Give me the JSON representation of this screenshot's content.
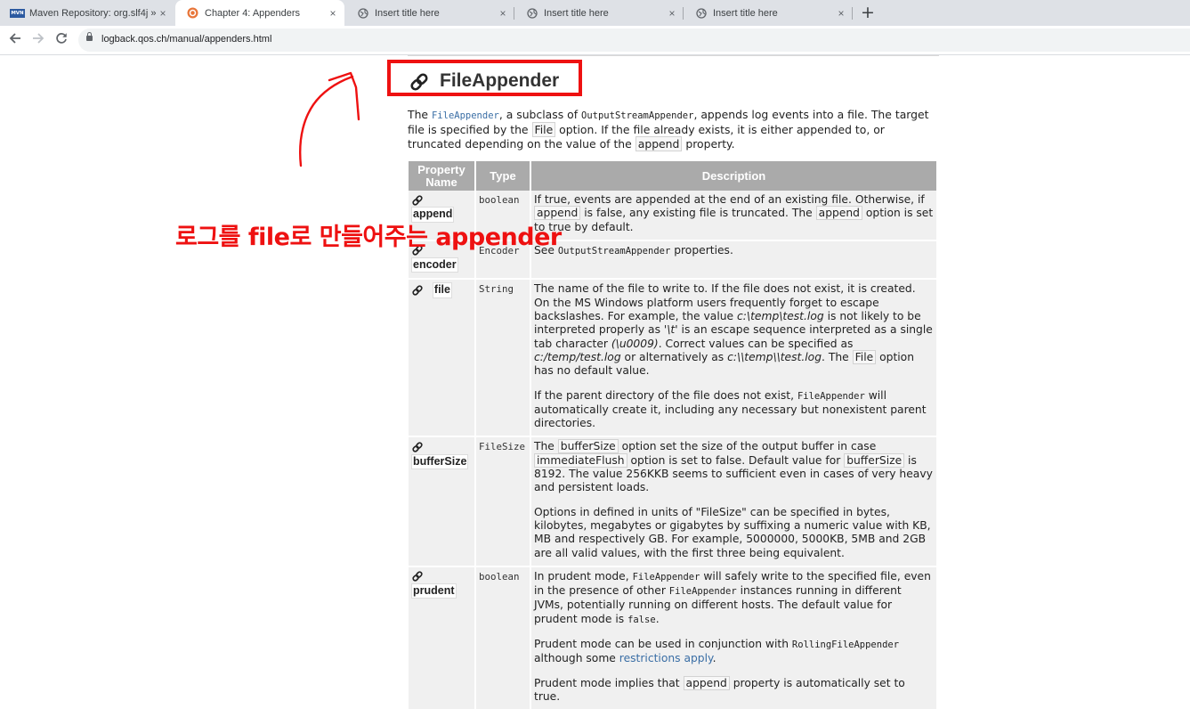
{
  "browser": {
    "tabs": [
      {
        "title": "Maven Repository: org.slf4j » slf",
        "icon": "maven-favicon",
        "active": false
      },
      {
        "title": "Chapter 4: Appenders",
        "icon": "logback-favicon",
        "active": true
      },
      {
        "title": "Insert title here",
        "icon": "globe-favicon",
        "active": false
      },
      {
        "title": "Insert title here",
        "icon": "globe-favicon",
        "active": false
      },
      {
        "title": "Insert title here",
        "icon": "globe-favicon",
        "active": false
      }
    ],
    "close_glyph": "×",
    "new_tab_glyph": "+",
    "maven_fav_text": "MVN",
    "url": "logback.qos.ch/manual/appenders.html"
  },
  "page": {
    "heading": "FileAppender",
    "intro": {
      "p1": "The ",
      "c1": "FileAppender",
      "p2": ", a subclass of ",
      "c2": "OutputStreamAppender",
      "p3": ", appends log events into a file. The target file is specified by the ",
      "c3": "File",
      "p4": " option. If the file already exists, it is either appended to, or truncated depending on the value of the ",
      "c4": "append",
      "p5": " property."
    },
    "table": {
      "headers": [
        "Property Name",
        "Type",
        "Description"
      ],
      "rows": [
        {
          "name": "append",
          "type": "boolean",
          "d1": "If true, events are appended at the end of an existing file. Otherwise, if ",
          "d1c": "append",
          "d1b": " is false, any existing file is truncated. The ",
          "d1d": "append",
          "d1e": " option is set to true by default."
        },
        {
          "name": "encoder",
          "type": "Encoder",
          "d1": "See ",
          "d1c": "OutputStreamAppender",
          "d1b": " properties."
        },
        {
          "name": "file",
          "type": "String",
          "d1": "The name of the file to write to. If the file does not exist, it is created. On the MS Windows platform users frequently forget to escape backslashes. For example, the value ",
          "d1i": "c:\\temp\\test.log",
          "d1b": " is not likely to be interpreted properly as ",
          "d1j": "'\\t'",
          "d1c": " is an escape sequence interpreted as a single tab character ",
          "d1k": "(\\u0009)",
          "d1d": ". Correct values can be specified as ",
          "d1l": "c:/temp/test.log",
          "d1e": " or alternatively as ",
          "d1m": "c:\\\\temp\\\\test.log",
          "d1f": ". The ",
          "d1n": "File",
          "d1g": " option has no default value.",
          "d2": "If the parent directory of the file does not exist, ",
          "d2c": "FileAppender",
          "d2b": " will automatically create it, including any necessary but nonexistent parent directories."
        },
        {
          "name": "bufferSize",
          "type": "FileSize",
          "d1": "The ",
          "d1c": "bufferSize",
          "d1b": " option set the size of the output buffer in case ",
          "d1d": "immediateFlush",
          "d1e": " option is set to false. Default value for ",
          "d1f": "bufferSize",
          "d1g": " is 8192. The value 256KKB seems to sufficient even in cases of very heavy and persistent loads.",
          "d2": "Options in defined in units of \"FileSize\" can be specified in bytes, kilobytes, megabytes or gigabytes by suffixing a numeric value with KB, MB and respectively GB. For example, 5000000, 5000KB, 5MB and 2GB are all valid values, with the first three being equivalent."
        },
        {
          "name": "prudent",
          "type": "boolean",
          "d1": "In prudent mode, ",
          "d1c": "FileAppender",
          "d1b": " will safely write to the specified file, even in the presence of other ",
          "d1d": "FileAppender",
          "d1e": " instances running in different JVMs, potentially running on different hosts. The default value for prudent mode is ",
          "d1f": "false",
          "d1g": ".",
          "d2": "Prudent mode can be used in conjunction with ",
          "d2c": "RollingFileAppender",
          "d2b": " although some ",
          "d2l": "restrictions apply",
          "d2e": ".",
          "d3": "Prudent mode implies that ",
          "d3c": "append",
          "d3b": " property is automatically set to true."
        }
      ]
    }
  },
  "annotation": {
    "text": "로그를 file로 만들어주는 appender",
    "color": "#ee1111"
  }
}
